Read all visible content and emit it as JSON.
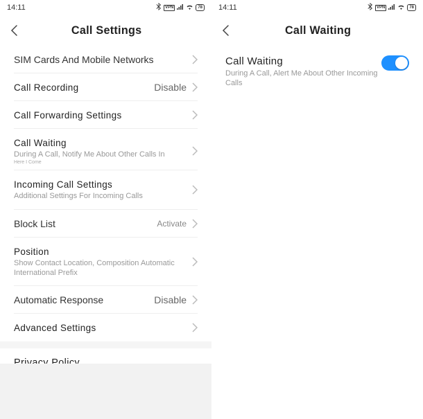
{
  "status": {
    "time": "14:11",
    "vpn": "VPN",
    "battery": "78"
  },
  "left": {
    "header": "Call Settings",
    "rows": {
      "sim": {
        "title": "SIM Cards And Mobile Networks"
      },
      "recording": {
        "title": "Call Recording",
        "value": "Disable"
      },
      "forwarding": {
        "title": "Call Forwarding Settings"
      },
      "waiting": {
        "title": "Call Waiting",
        "subtitle": "During A Call, Notify Me About Other Calls In",
        "tiny": "Here I Come"
      },
      "incoming": {
        "title": "Incoming Call Settings",
        "subtitle": "Additional Settings For Incoming Calls"
      },
      "block": {
        "title": "Block List",
        "value": "Activate"
      },
      "position": {
        "title": "Position",
        "subtitle": "Show Contact Location, Composition Automatic International Prefix"
      },
      "auto": {
        "title": "Automatic Response",
        "value": "Disable"
      },
      "advanced": {
        "title": "Advanced Settings"
      },
      "privacy": {
        "title": "Privacy Policy"
      }
    }
  },
  "right": {
    "header": "Call Waiting",
    "row": {
      "title": "Call Waiting",
      "subtitle": "During A Call, Alert Me About Other Incoming Calls"
    }
  }
}
